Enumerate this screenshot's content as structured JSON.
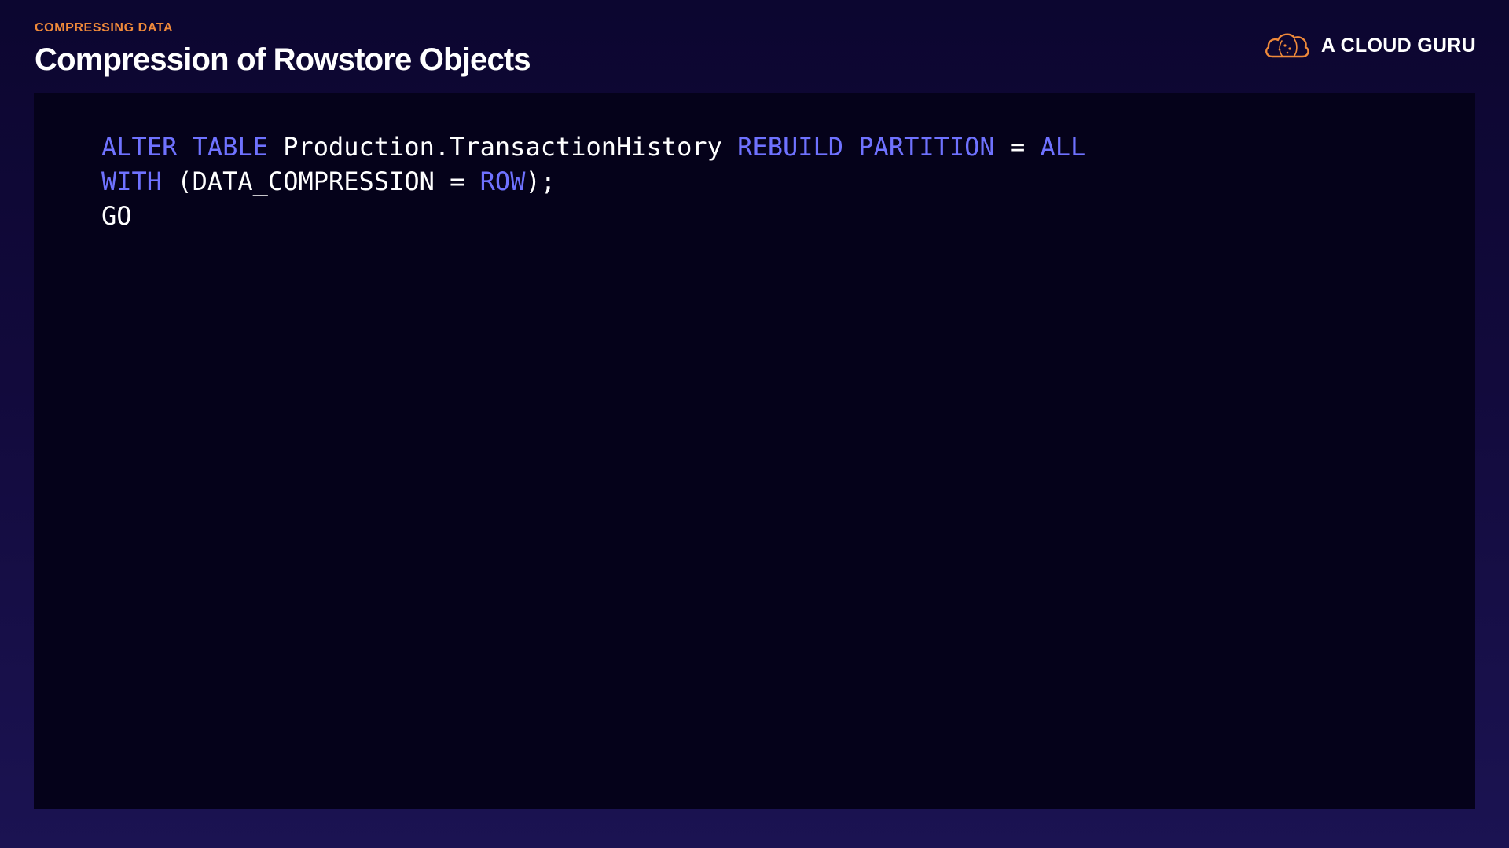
{
  "header": {
    "eyebrow": "COMPRESSING DATA",
    "title": "Compression of Rowstore Objects"
  },
  "brand": {
    "name": "A CLOUD GURU",
    "logo_icon": "cloud-logo-icon",
    "accent_color": "#f08a3a"
  },
  "colors": {
    "keyword": "#6f72ff",
    "text": "#ffffff",
    "eyebrow": "#f08a3a",
    "panel_background": "#05021a"
  },
  "code": {
    "lines": [
      {
        "tokens": [
          {
            "text": "ALTER TABLE",
            "kind": "keyword"
          },
          {
            "text": " Production.TransactionHistory ",
            "kind": "text"
          },
          {
            "text": "REBUILD PARTITION",
            "kind": "keyword"
          },
          {
            "text": " = ",
            "kind": "text"
          },
          {
            "text": "ALL",
            "kind": "keyword"
          }
        ]
      },
      {
        "tokens": [
          {
            "text": "WITH",
            "kind": "keyword"
          },
          {
            "text": " (DATA_COMPRESSION = ",
            "kind": "text"
          },
          {
            "text": "ROW",
            "kind": "keyword"
          },
          {
            "text": ");",
            "kind": "text"
          }
        ]
      },
      {
        "tokens": [
          {
            "text": "GO",
            "kind": "text"
          }
        ]
      }
    ]
  }
}
